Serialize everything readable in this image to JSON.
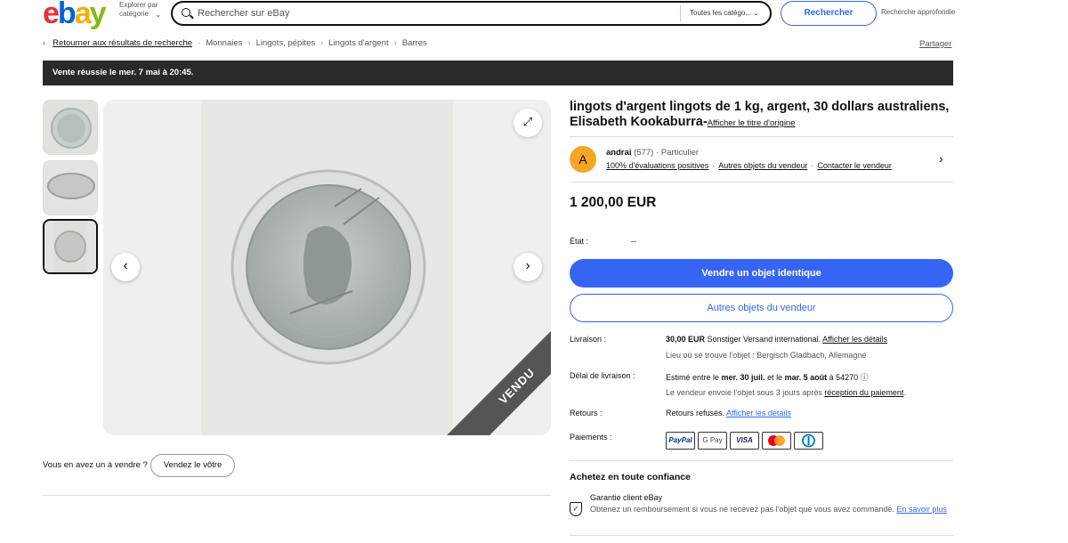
{
  "header": {
    "logo_letters": [
      "e",
      "b",
      "a",
      "y"
    ],
    "logo_colors": [
      "#e53238",
      "#0064d2",
      "#f5af02",
      "#86b817"
    ],
    "explore_label": "Explorer par catégorie",
    "search_placeholder": "Rechercher sur eBay",
    "category_select": "Toutes les catégo...",
    "search_button": "Rechercher",
    "advanced_search": "Recherche approfondie"
  },
  "breadcrumb": {
    "back": "Retourner aux résultats de recherche",
    "items": [
      "Monnaies",
      "Lingots, pépites",
      "Lingots d'argent",
      "Barres"
    ],
    "share": "Partager"
  },
  "banner": "Vente réussie le mer. 7 mai à 20:45.",
  "gallery": {
    "sold_ribbon": "VENDU",
    "selected_thumbnail": 3
  },
  "sell_prompt": {
    "question": "Vous en avez un à vendre ?",
    "button": "Vendez le vôtre"
  },
  "listing": {
    "title": "lingots d'argent lingots de 1 kg, argent, 30 dollars australiens, Elisabeth Kookaburra-",
    "original_title_link": "Afficher le titre d'origine",
    "price": "1 200,00 EUR"
  },
  "seller": {
    "initial": "A",
    "name": "andrai",
    "feedback_count": "(577)",
    "type": "· Particulier",
    "positive": "100% d'évaluations positives",
    "other_items": "Autres objets du vendeur",
    "contact": "Contacter le vendeur"
  },
  "condition": {
    "label": "État :",
    "value": "--"
  },
  "buttons": {
    "sell_similar": "Vendre un objet identique",
    "seller_items": "Autres objets du vendeur"
  },
  "shipping": {
    "label": "Livraison :",
    "amount": "30,00 EUR",
    "method": " Sonstiger Versand international. ",
    "details_link": "Afficher les détails",
    "location": "Lieu où se trouve l'objet : Bergisch Gladbach, Allemagne"
  },
  "delivery": {
    "label": "Délai de livraison :",
    "prefix": "Estimé entre le ",
    "date1": "mer. 30 juil.",
    "middle": " et le ",
    "date2": "mar. 5 août",
    "suffix": " à 54270 ⓘ",
    "note_prefix": "Le vendeur envoie l'objet sous 3 jours après ",
    "note_link": "réception du paiement",
    "note_suffix": "."
  },
  "returns": {
    "label": "Retours :",
    "text": "Retours refusés. ",
    "link": "Afficher les détails"
  },
  "payments": {
    "label": "Paiements :",
    "methods": [
      "PayPal",
      "G Pay",
      "VISA",
      "Mastercard",
      "Diners"
    ]
  },
  "trust": {
    "heading": "Achetez en toute confiance",
    "guarantee_title": "Garantie client eBay",
    "guarantee_text": "Obtenez un remboursement si vous ne recevez pas l'objet que vous avez commandé. ",
    "learn_more": "En savoir plus"
  }
}
